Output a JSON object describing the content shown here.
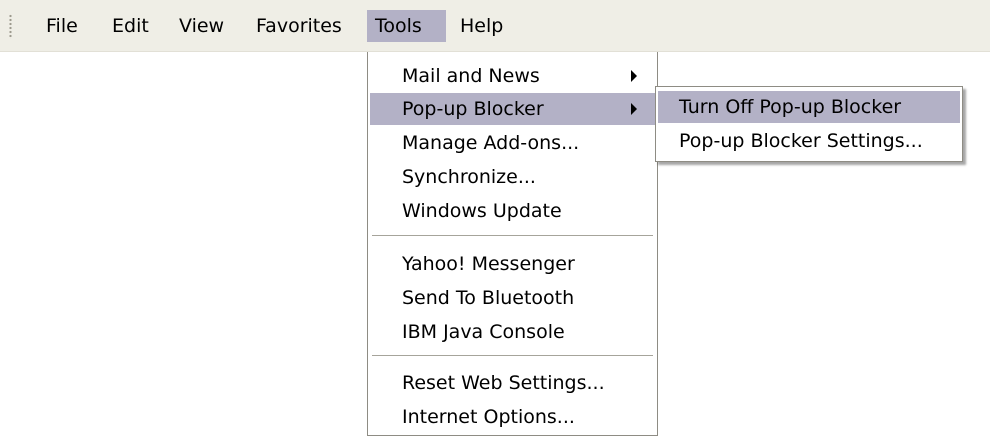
{
  "menubar": {
    "items": [
      {
        "label": "File"
      },
      {
        "label": "Edit"
      },
      {
        "label": "View"
      },
      {
        "label": "Favorites"
      },
      {
        "label": "Tools",
        "active": true
      },
      {
        "label": "Help"
      }
    ]
  },
  "tools_menu": {
    "items": [
      {
        "label": "Mail and News",
        "has_submenu": true
      },
      {
        "label": "Pop-up Blocker",
        "has_submenu": true,
        "highlighted": true
      },
      {
        "label": "Manage Add-ons..."
      },
      {
        "label": "Synchronize..."
      },
      {
        "label": "Windows Update"
      },
      {
        "label": "Yahoo! Messenger"
      },
      {
        "label": "Send To Bluetooth"
      },
      {
        "label": "IBM Java Console"
      },
      {
        "label": "Reset Web Settings..."
      },
      {
        "label": "Internet Options..."
      }
    ]
  },
  "popup_blocker_submenu": {
    "items": [
      {
        "label": "Turn Off Pop-up Blocker",
        "highlighted": true
      },
      {
        "label": "Pop-up Blocker Settings..."
      }
    ]
  },
  "colors": {
    "menubar_bg": "#efeee6",
    "highlight": "#b3b1c6",
    "menu_bg": "#ffffff",
    "border": "#8e8c84"
  },
  "icons": [
    "menubar-grip-icon",
    "submenu-arrow-icon"
  ]
}
